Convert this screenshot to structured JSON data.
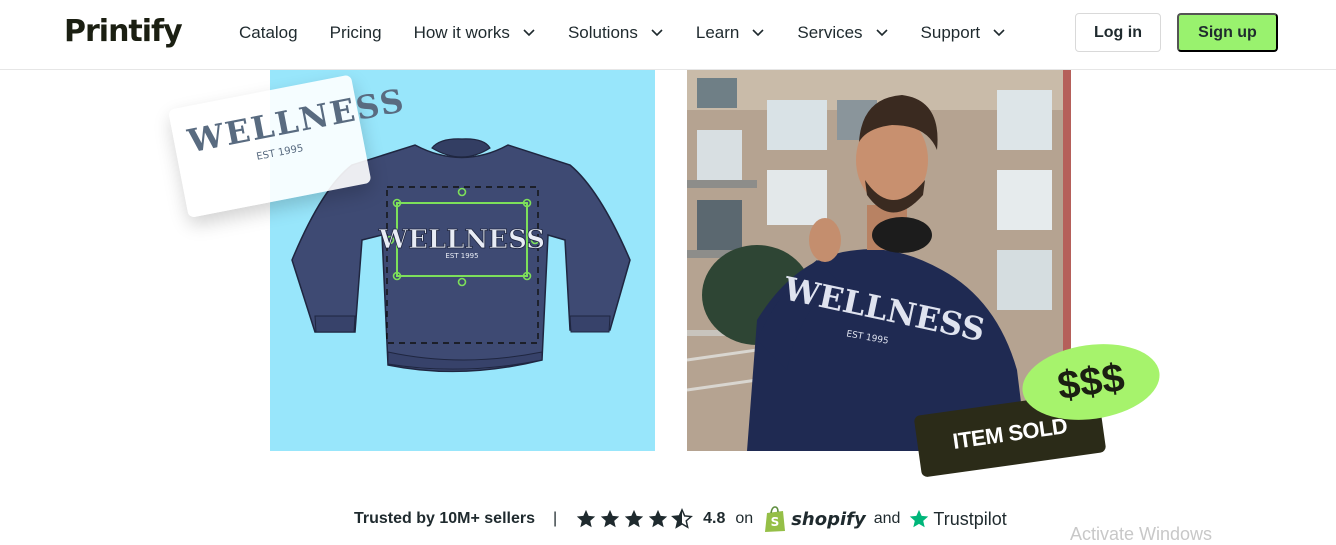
{
  "brand": {
    "logo": "Printify"
  },
  "nav": {
    "items": [
      {
        "label": "Catalog",
        "dropdown": false
      },
      {
        "label": "Pricing",
        "dropdown": false
      },
      {
        "label": "How it works",
        "dropdown": true
      },
      {
        "label": "Solutions",
        "dropdown": true
      },
      {
        "label": "Learn",
        "dropdown": true
      },
      {
        "label": "Services",
        "dropdown": true
      },
      {
        "label": "Support",
        "dropdown": true
      }
    ],
    "login_label": "Log in",
    "signup_label": "Sign up"
  },
  "hero": {
    "card_title": "WELLNESS",
    "card_sub": "EST 1995",
    "design_title": "WELLNESS",
    "design_sub": "EST 1995",
    "shirt_title": "WELLNESS",
    "shirt_sub": "EST 1995",
    "money_label": "$$$",
    "sold_label": "ITEM SOLD"
  },
  "trust": {
    "trusted_label": "Trusted by 10M+ sellers",
    "separator": "|",
    "rating": "4.8",
    "on_label": "on",
    "shopify_label": "shopify",
    "and_label": "and",
    "trustpilot_label": "Trustpilot",
    "stars": 4.5
  },
  "os": {
    "watermark": "Activate Windows"
  },
  "colors": {
    "accent_green": "#99f26e",
    "sky_blue": "#98e6fb",
    "navy": "#3c4a72",
    "dark_olive": "#2b2b18",
    "trustpilot_green": "#00b67a",
    "shopify_green": "#95bf47"
  }
}
